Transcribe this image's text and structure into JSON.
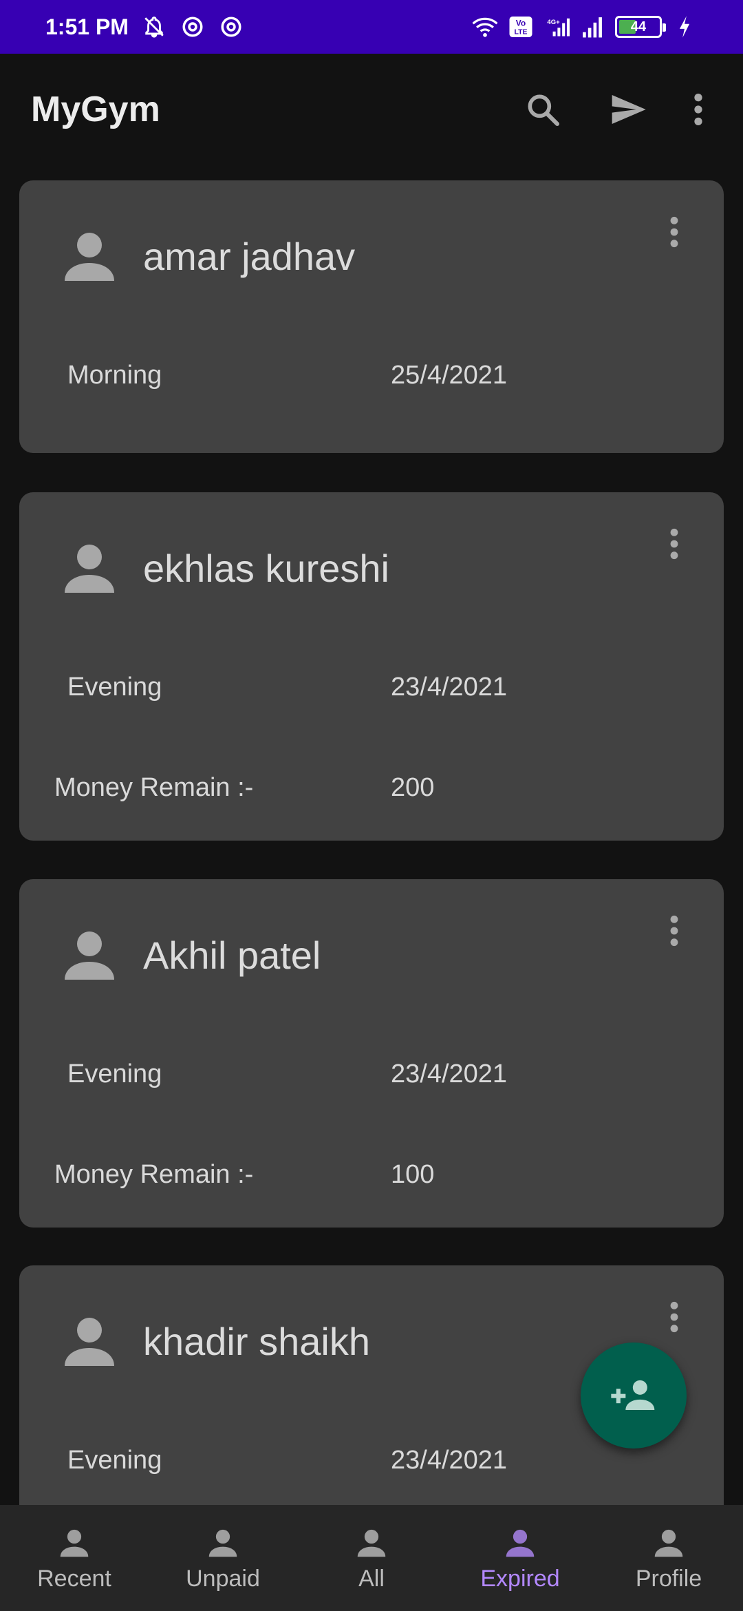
{
  "status_bar": {
    "time": "1:51 PM",
    "battery": "44",
    "icons": [
      "mute-icon",
      "sync-icon",
      "sync-icon",
      "wifi-icon",
      "volte-icon",
      "signal-icon",
      "signal-icon",
      "battery-icon",
      "charging-icon"
    ]
  },
  "app_bar": {
    "title": "MyGym",
    "actions": [
      "search-icon",
      "send-icon",
      "more-vert-icon"
    ]
  },
  "members": [
    {
      "name": "amar jadhav",
      "shift": "Morning",
      "date": "25/4/2021",
      "money_label": "",
      "money": ""
    },
    {
      "name": "ekhlas kureshi",
      "shift": "Evening",
      "date": "23/4/2021",
      "money_label": "Money Remain :-",
      "money": "200"
    },
    {
      "name": "Akhil patel",
      "shift": "Evening",
      "date": "23/4/2021",
      "money_label": "Money Remain :-",
      "money": "100"
    },
    {
      "name": "khadir shaikh",
      "shift": "Evening",
      "date": "23/4/2021",
      "money_label": "",
      "money": ""
    }
  ],
  "fab": {
    "icon": "add-person-icon"
  },
  "bottom_nav": {
    "active_index": 3,
    "active_color": "#b388ff",
    "items": [
      {
        "label": "Recent",
        "icon": "person-icon"
      },
      {
        "label": "Unpaid",
        "icon": "person-icon"
      },
      {
        "label": "All",
        "icon": "person-icon"
      },
      {
        "label": "Expired",
        "icon": "person-icon"
      },
      {
        "label": "Profile",
        "icon": "person-icon"
      }
    ]
  },
  "colors": {
    "status_bar": "#3700b3",
    "background": "#121212",
    "card": "#424242",
    "fab": "#015f4d",
    "bottom_nav": "#262626"
  }
}
